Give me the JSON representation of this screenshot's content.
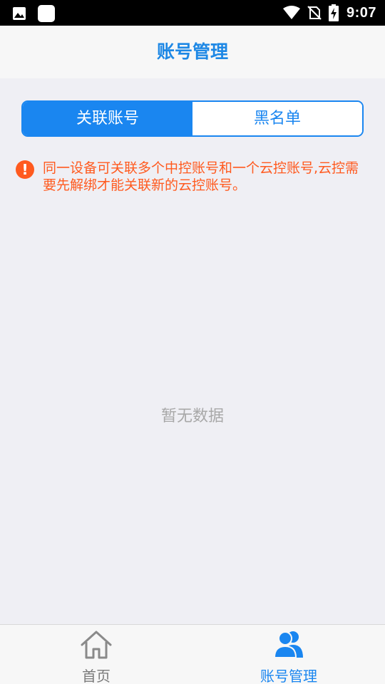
{
  "status_bar": {
    "time": "9:07",
    "icons": [
      "image-icon",
      "square-app-icon",
      "wifi-icon",
      "no-sim-icon",
      "battery-charging-icon"
    ]
  },
  "header": {
    "title": "账号管理"
  },
  "segmented": {
    "tabs": [
      {
        "label": "关联账号",
        "active": true
      },
      {
        "label": "黑名单",
        "active": false
      }
    ]
  },
  "notice": {
    "icon": "!",
    "text": "同一设备可关联多个中控账号和一个云控账号,云控需要先解绑才能关联新的云控账号。"
  },
  "empty_state": {
    "text": "暂无数据"
  },
  "bottom_nav": {
    "items": [
      {
        "label": "首页",
        "icon": "home-icon",
        "active": false
      },
      {
        "label": "账号管理",
        "icon": "users-icon",
        "active": true
      }
    ]
  },
  "colors": {
    "accent": "#1a86f0",
    "warning": "#ff5a1f",
    "muted": "#a8a8a8"
  }
}
